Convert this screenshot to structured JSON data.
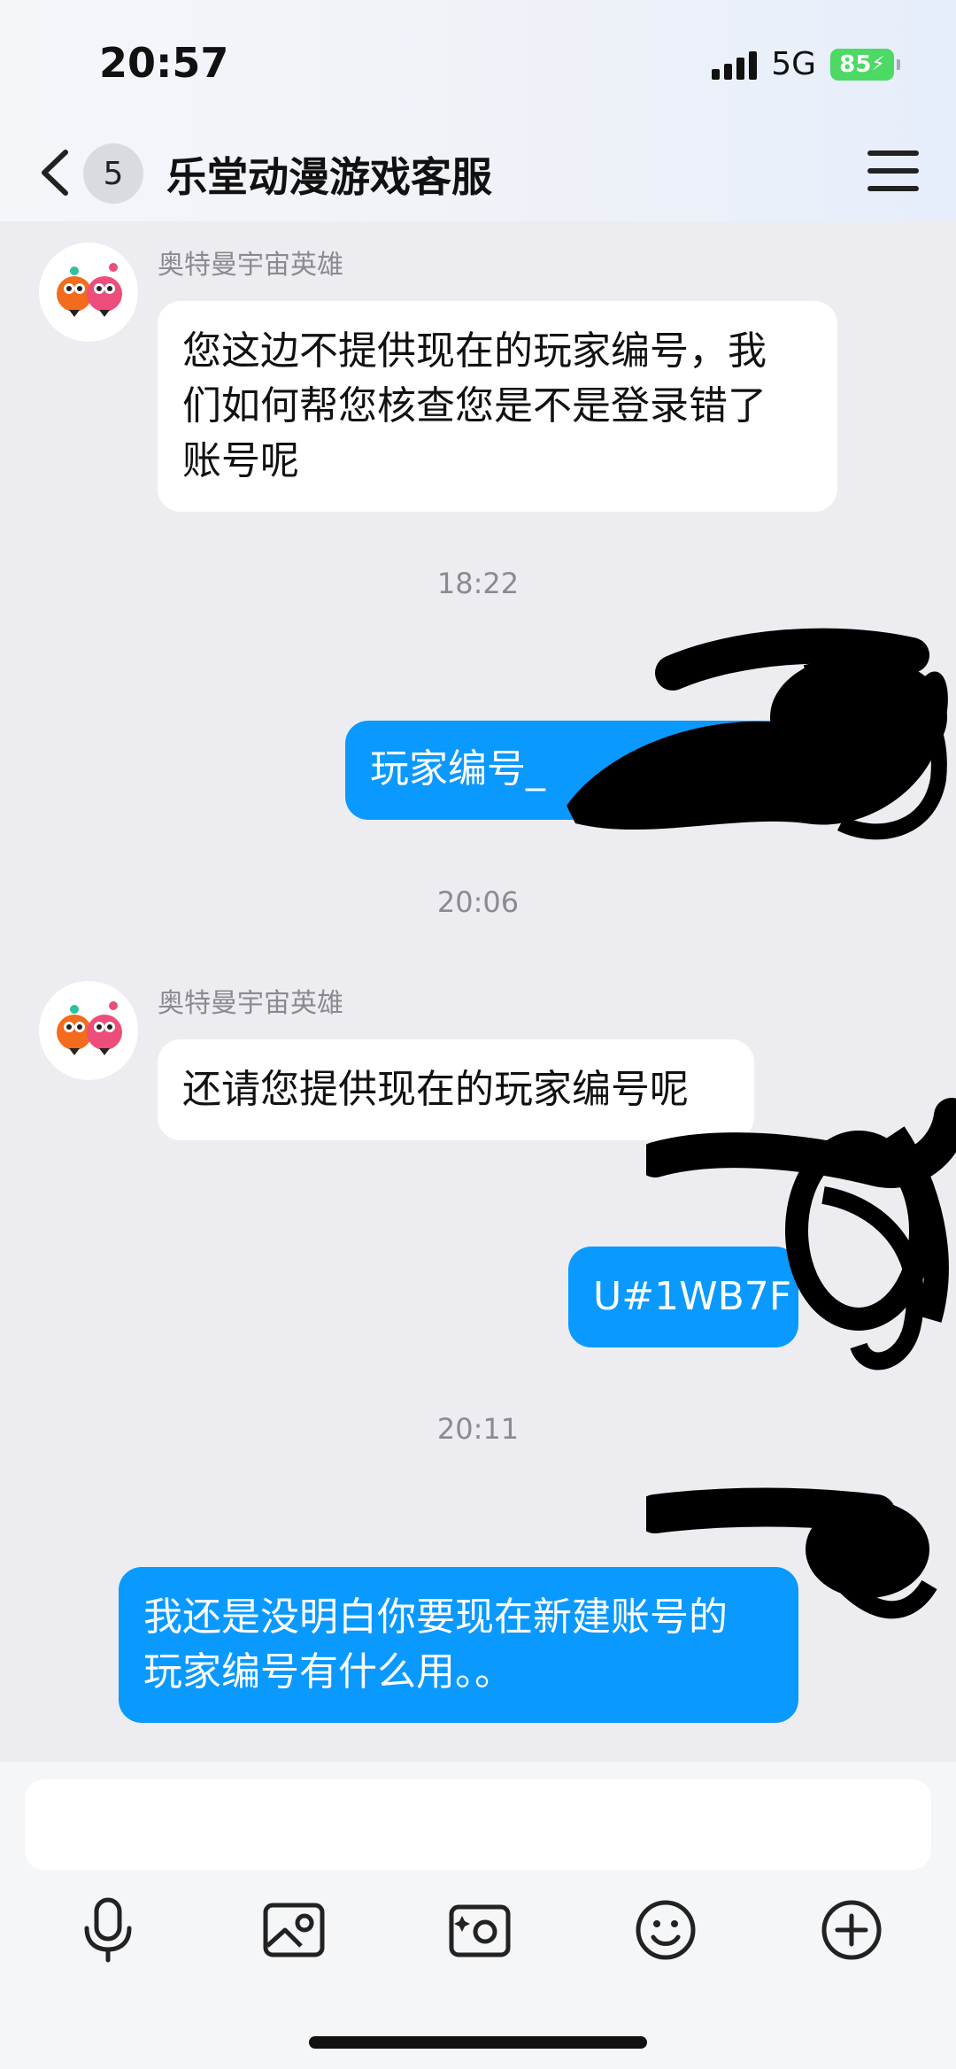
{
  "status_bar": {
    "time": "20:57",
    "network": "5G",
    "battery": "85"
  },
  "header": {
    "unread_count": "5",
    "title": "乐堂动漫游戏客服"
  },
  "messages": [
    {
      "sender": "奥特曼宇宙英雄",
      "text_lines": [
        "您这边不提供现在的玩家编号，我",
        "们如何帮您核查您是不是登录错了",
        "账号呢"
      ]
    },
    {
      "time": "18:22"
    },
    {
      "text": "玩家编号_"
    },
    {
      "time": "20:06"
    },
    {
      "sender": "奥特曼宇宙英雄",
      "text": "还请您提供现在的玩家编号呢"
    },
    {
      "text": "U#1WB7F"
    },
    {
      "time": "20:11"
    },
    {
      "text_lines": [
        "我还是没明白你要现在新建账号的",
        "玩家编号有什么用。。"
      ]
    }
  ],
  "toolbar": {
    "icons": [
      "microphone-icon",
      "image-icon",
      "camera-icon",
      "emoji-icon",
      "plus-icon"
    ]
  },
  "colors": {
    "outgoing_bubble": "#0a99ff",
    "incoming_bubble": "#ffffff",
    "background": "#ededf1"
  }
}
